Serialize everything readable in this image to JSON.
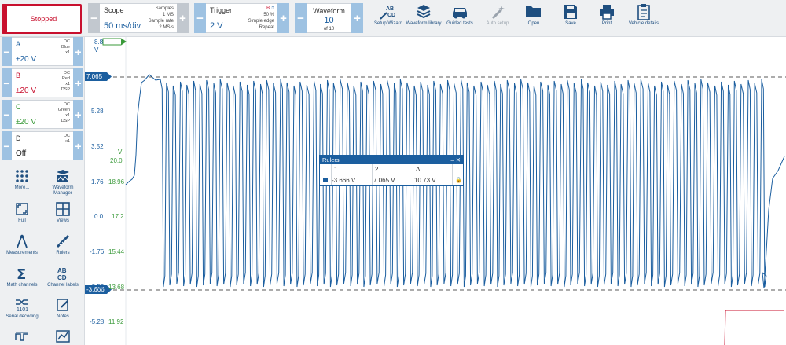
{
  "toolbar": {
    "status": "Stopped",
    "scope": {
      "title": "Scope",
      "value": "50 ms/div",
      "samples_label": "Samples",
      "samples": "1 MS",
      "rate_label": "Sample rate",
      "rate": "2 MS/s"
    },
    "trigger": {
      "title": "Trigger",
      "value": "2 V",
      "source": "B",
      "level": "50 %",
      "type": "Simple edge",
      "mode": "Repeat"
    },
    "waveform": {
      "title": "Waveform",
      "value": "10",
      "of": "of 10"
    },
    "buttons": [
      {
        "label": "Setup Wizard",
        "icon": "setup-wizard-icon"
      },
      {
        "label": "Waveform library",
        "icon": "waveform-library-icon"
      },
      {
        "label": "Guided tests",
        "icon": "car-icon"
      },
      {
        "label": "Auto setup",
        "icon": "magic-wand-icon"
      },
      {
        "label": "Open",
        "icon": "folder-icon"
      },
      {
        "label": "Save",
        "icon": "save-icon"
      },
      {
        "label": "Print",
        "icon": "printer-icon"
      },
      {
        "label": "Vehicle details",
        "icon": "clipboard-icon"
      }
    ]
  },
  "channels": [
    {
      "name": "A",
      "range": "±20 V",
      "coupling": "DC",
      "color_name": "Blue",
      "probe": "x1",
      "dsp": "",
      "color": "#1b5e9f"
    },
    {
      "name": "B",
      "range": "±20 V",
      "coupling": "DC",
      "color_name": "Red",
      "probe": "x1",
      "dsp": "DSP",
      "color": "#c8102e"
    },
    {
      "name": "C",
      "range": "±20 V",
      "coupling": "DC",
      "color_name": "Green",
      "probe": "x1",
      "dsp": "DSP",
      "color": "#3a9a3a"
    },
    {
      "name": "D",
      "range": "Off",
      "coupling": "DC",
      "color_name": "",
      "probe": "x1",
      "dsp": "",
      "color": "#222222"
    }
  ],
  "tools": [
    {
      "label": "More...",
      "icon": "more-icon"
    },
    {
      "label": "Waveform Manager",
      "icon": "waveform-manager-icon"
    },
    {
      "label": "Full",
      "icon": "fullscreen-icon"
    },
    {
      "label": "Views",
      "icon": "views-grid-icon"
    },
    {
      "label": "Measurements",
      "icon": "measurements-icon"
    },
    {
      "label": "Rulers",
      "icon": "rulers-icon"
    },
    {
      "label": "Math channels",
      "icon": "sigma-icon"
    },
    {
      "label": "Channel labels",
      "icon": "channel-labels-icon"
    },
    {
      "label": "Serial decoding",
      "icon": "serial-decoding-icon"
    },
    {
      "label": "Notes",
      "icon": "notes-icon"
    },
    {
      "label": "",
      "icon": "filter-icon"
    },
    {
      "label": "",
      "icon": "chart-icon"
    }
  ],
  "plot": {
    "axis_top": "8.8",
    "axis_unit": "V",
    "a_ticks": [
      "5.28",
      "3.52",
      "1.76",
      "0.0",
      "-1.76",
      "-3.52",
      "-5.28"
    ],
    "c_unit": "V",
    "c_ticks": [
      "20.0",
      "18.96",
      "17.2",
      "15.44",
      "13.68",
      "11.92"
    ],
    "ruler_hi": "7.065",
    "ruler_lo": "-3.666"
  },
  "rulers_panel": {
    "title": "Rulers",
    "headers": [
      "1",
      "2",
      "Δ"
    ],
    "values": [
      "-3.666 V",
      "7.065 V",
      "10.73 V"
    ]
  },
  "colors": {
    "accent": "#1b5e9f",
    "stopped": "#c8102e",
    "channel_c": "#3a9a3a"
  }
}
